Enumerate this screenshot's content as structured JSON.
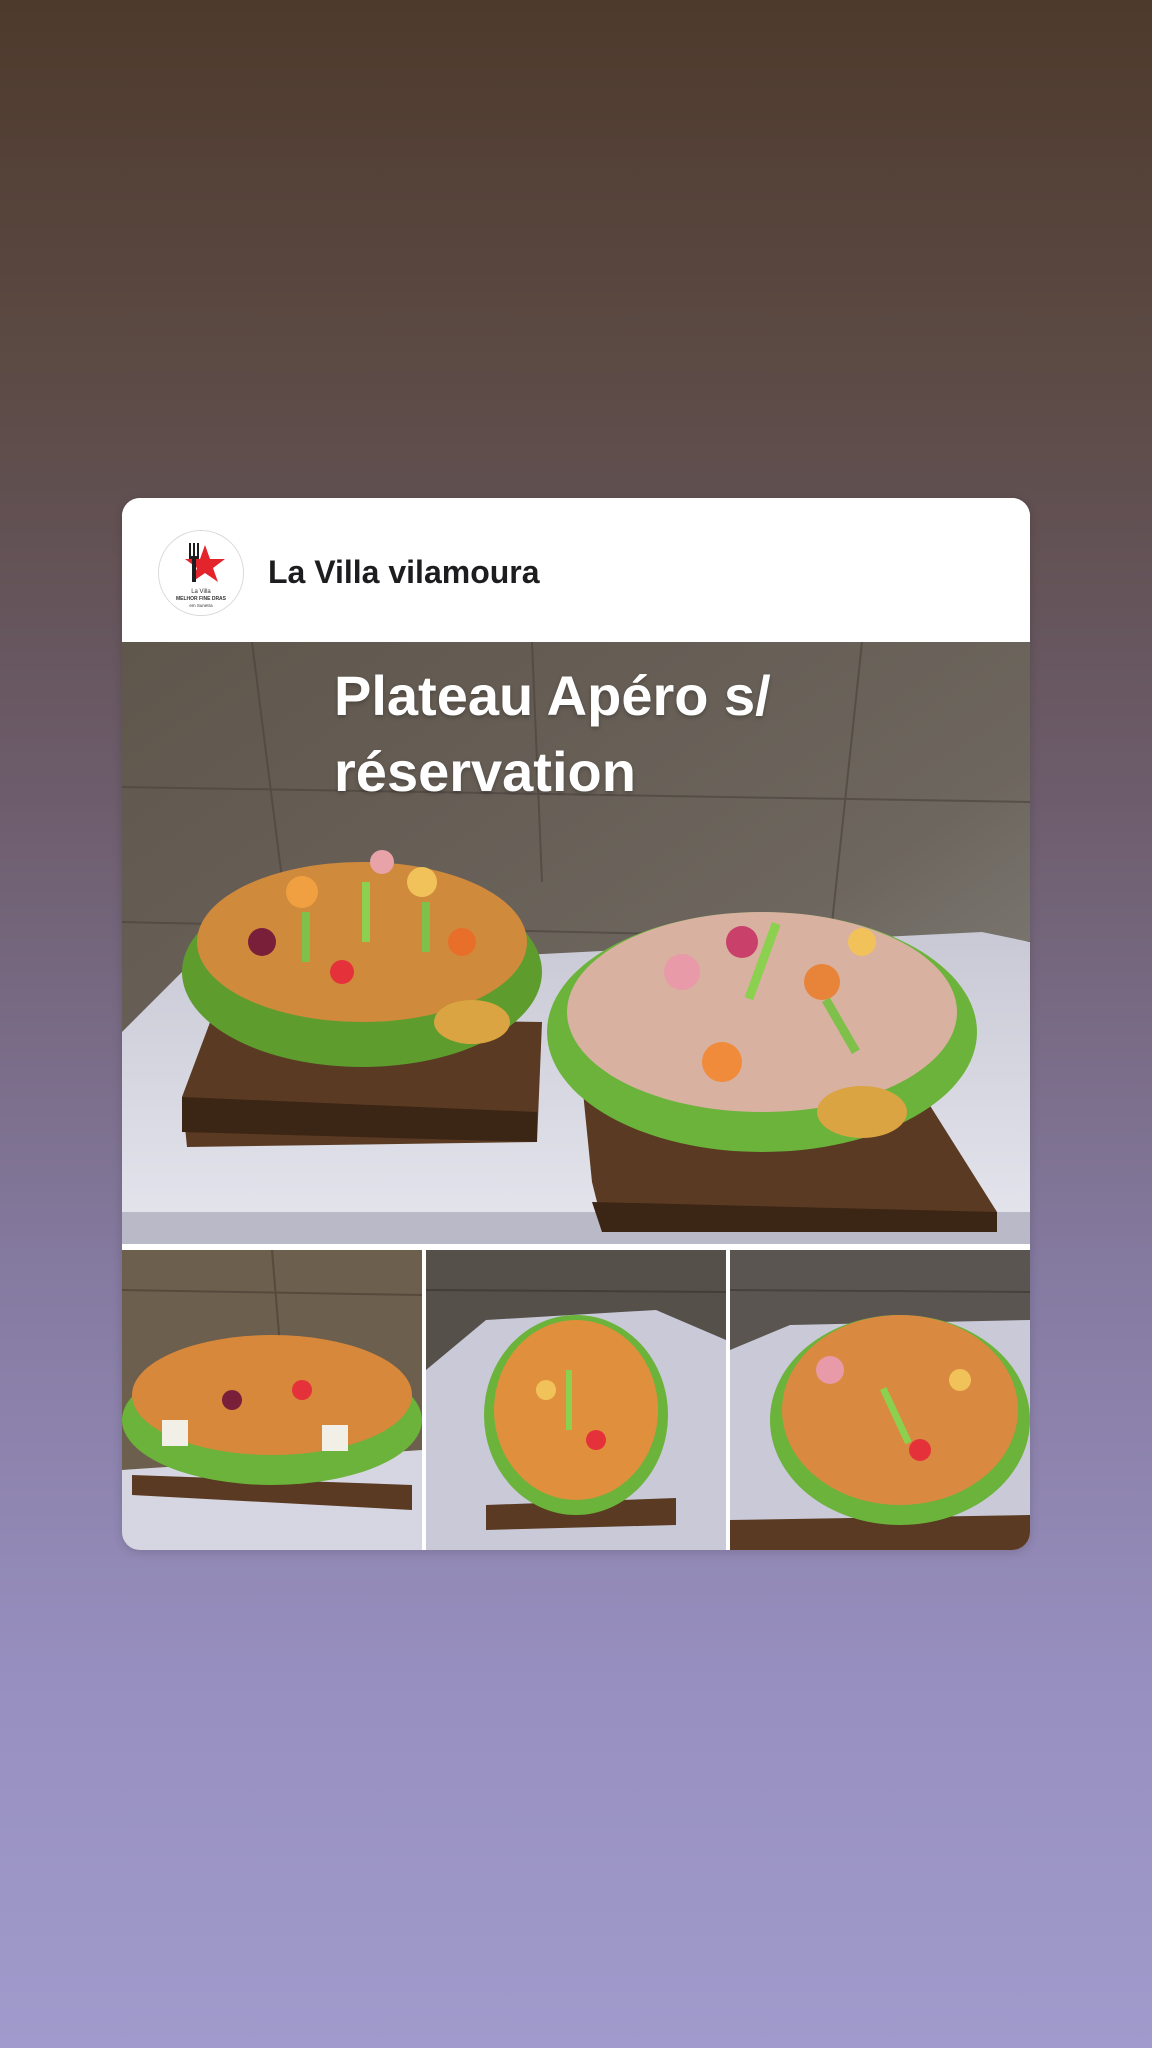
{
  "post": {
    "account_name": "La Villa vilamoura",
    "avatar": {
      "icon": "star-fork-logo",
      "brand_color": "#e3242b",
      "line1": "La Villa",
      "line2": "MELHOR FINE DRAS",
      "line3": "em Sunetra"
    },
    "headline": "Plateau Apéro s/ réservation",
    "images": [
      {
        "label": "main-platter-photo"
      },
      {
        "label": "platter-thumbnail-1"
      },
      {
        "label": "platter-thumbnail-2"
      },
      {
        "label": "platter-thumbnail-3"
      }
    ]
  },
  "colors": {
    "background_top": "#4e3a2c",
    "background_bottom": "#a09bcc",
    "card": "#ffffff",
    "accent": "#e3242b"
  }
}
